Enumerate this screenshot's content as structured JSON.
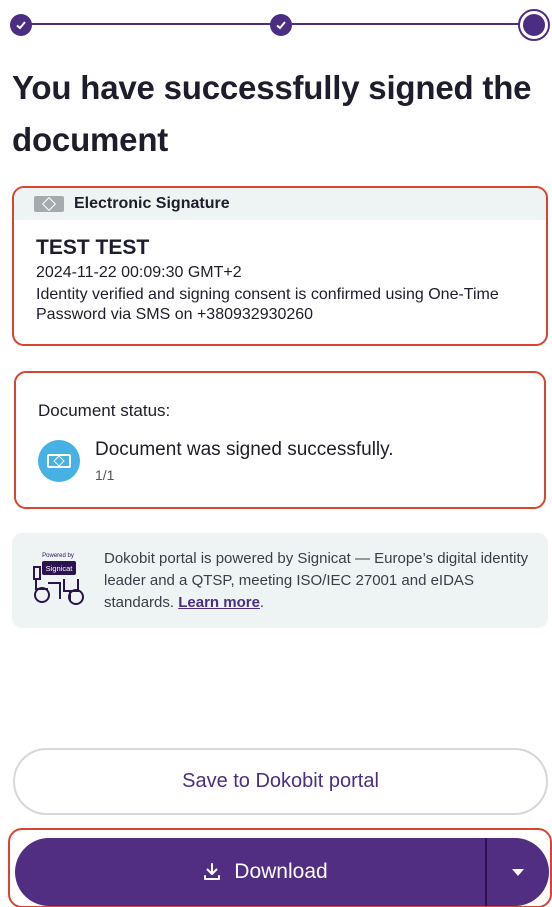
{
  "page": {
    "title": "You have successfully signed the document"
  },
  "stepper": {
    "steps": [
      {
        "state": "done"
      },
      {
        "state": "done"
      },
      {
        "state": "current"
      }
    ]
  },
  "signature": {
    "type_label": "Electronic Signature",
    "name": "TEST TEST",
    "datetime": "2024-11-22 00:09:30 GMT+2",
    "description": "Identity verified and signing consent is confirmed using One-Time Password via SMS on +380932930260"
  },
  "status": {
    "label": "Document status:",
    "message": "Document was signed successfully.",
    "count": "1/1"
  },
  "info": {
    "logo_powered_by": "Powered by",
    "logo_brand": "Signicat",
    "text": "Dokobit portal is powered by Signicat — Europe’s digital identity leader and a QTSP, meeting ISO/IEC 27001 and eIDAS standards.",
    "link_label": "Learn more",
    "link_suffix": "."
  },
  "actions": {
    "save_label": "Save to Dokobit portal",
    "download_label": "Download"
  },
  "colors": {
    "brand_purple": "#522e83",
    "highlight_red": "#d9442f",
    "status_blue": "#47b1e4"
  }
}
